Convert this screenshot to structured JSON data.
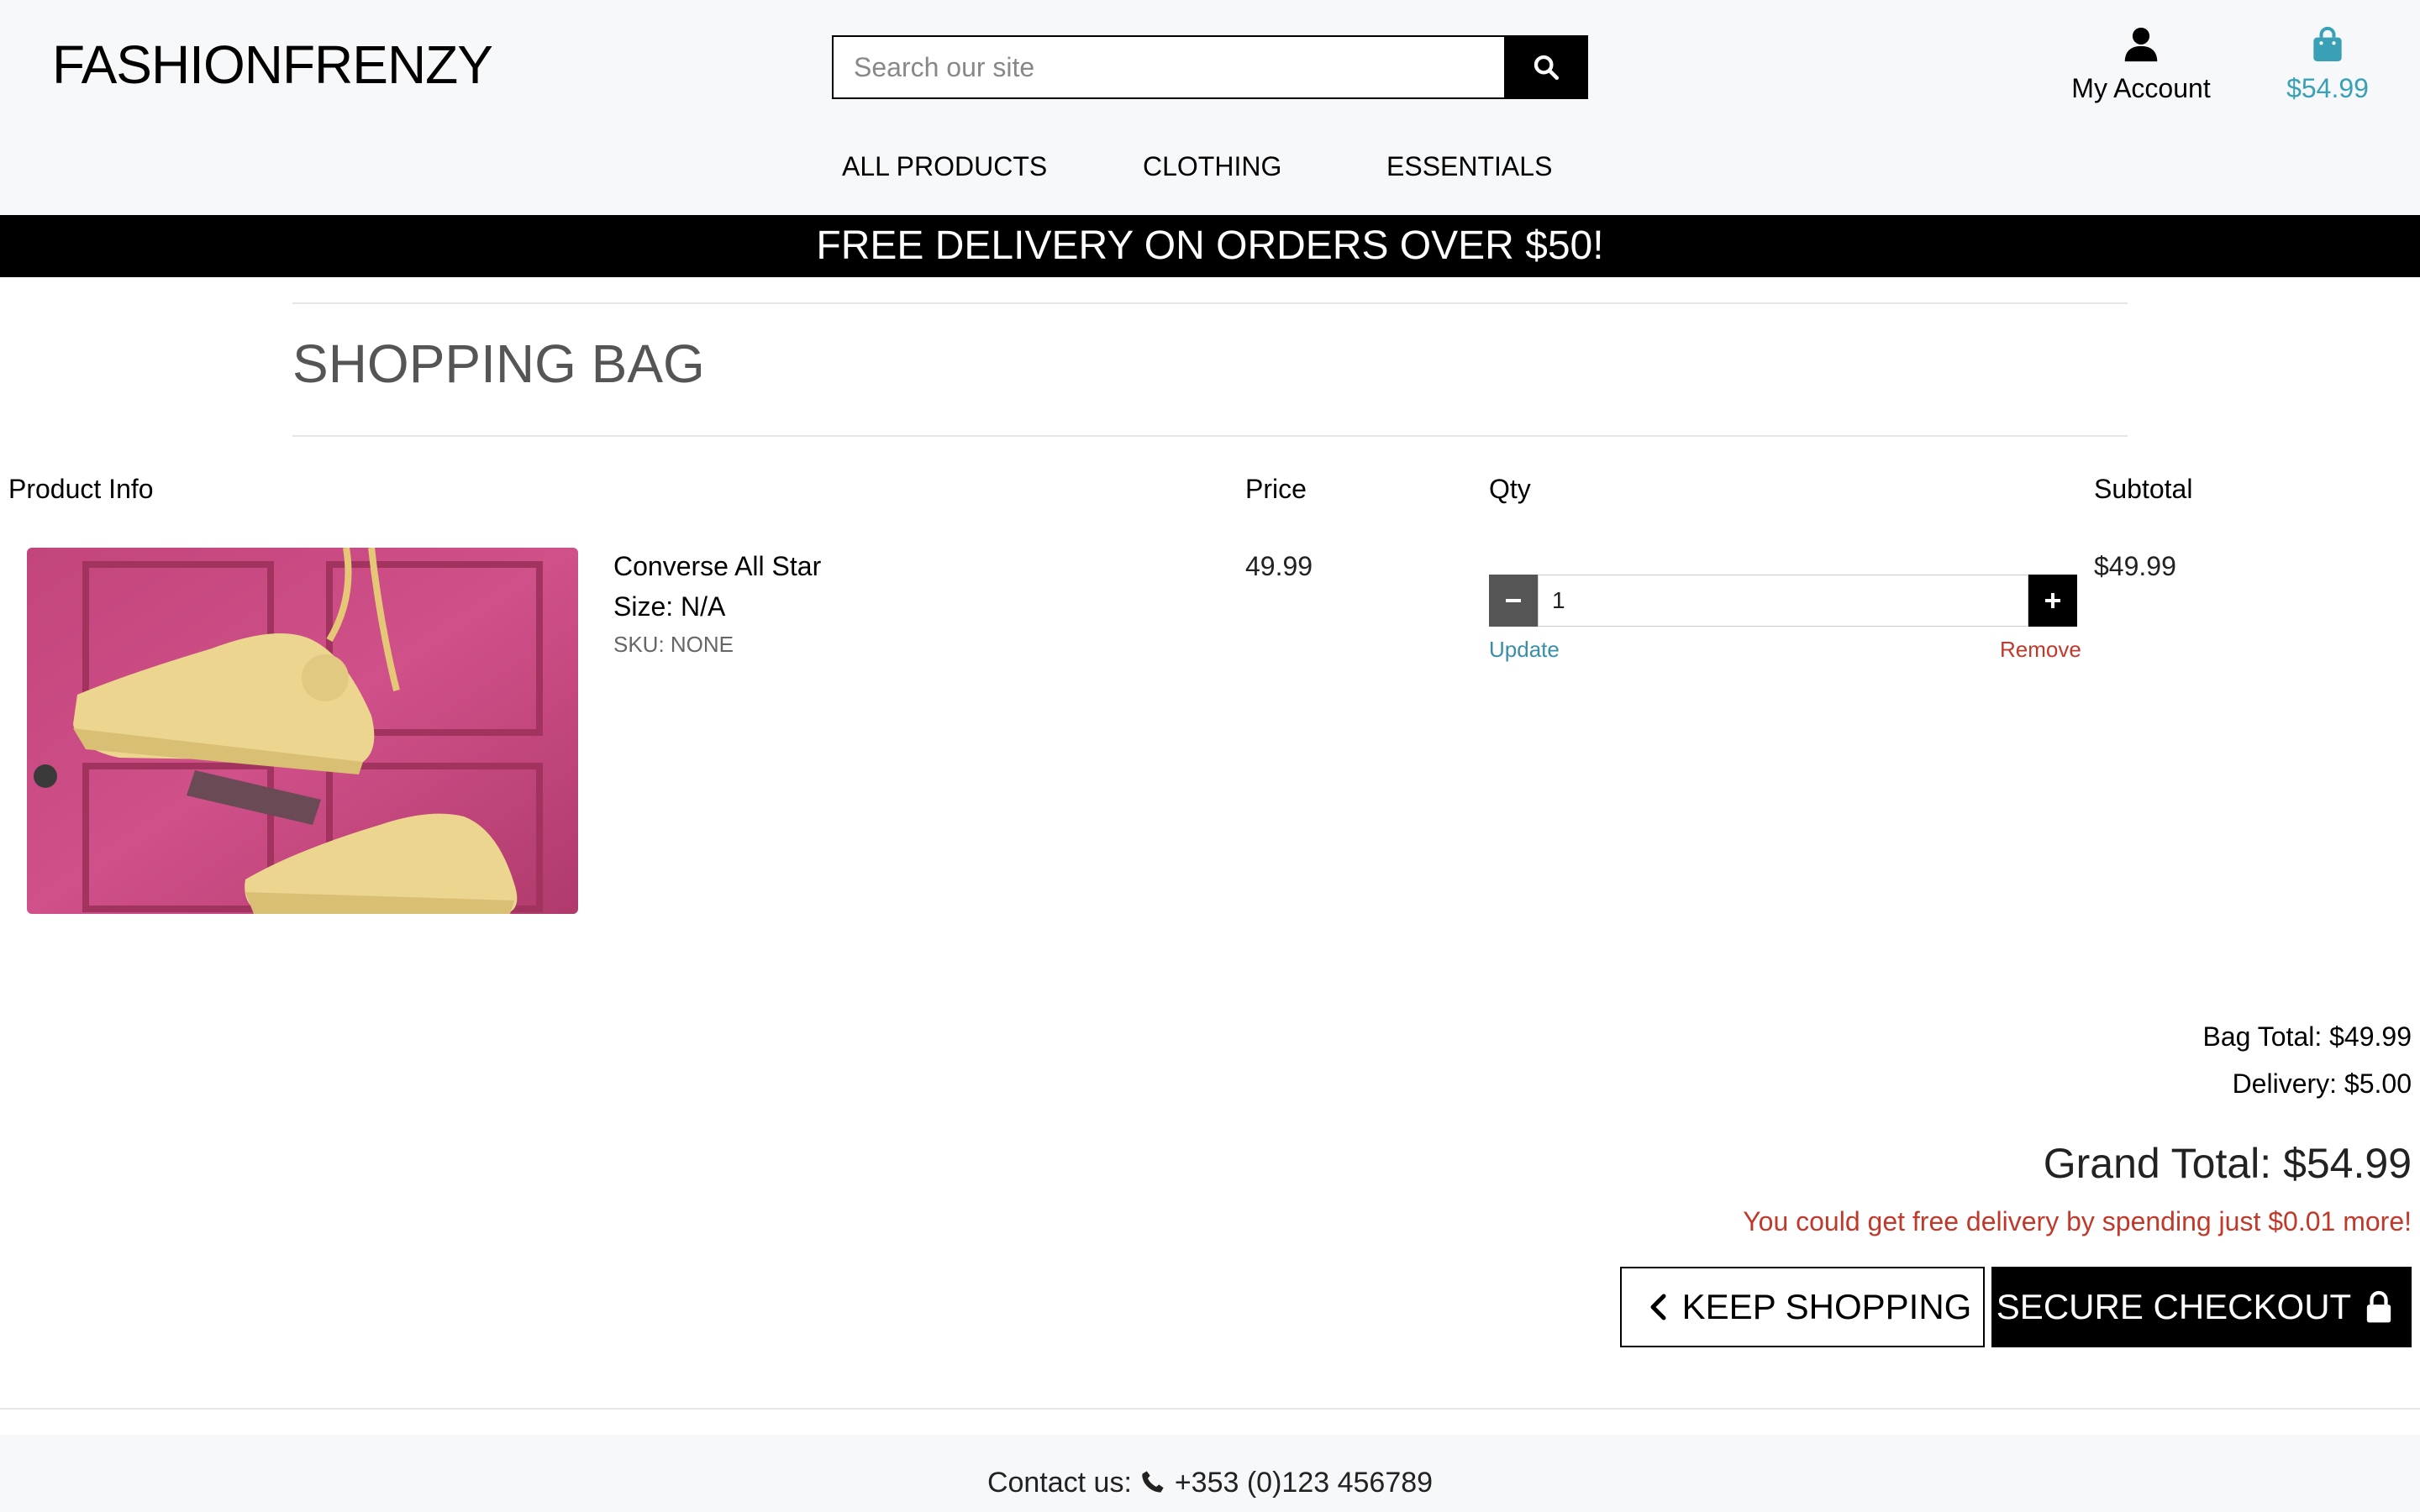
{
  "brand": {
    "logo": "FASHIONFRENZY"
  },
  "search": {
    "placeholder": "Search our site"
  },
  "account": {
    "label": "My Account"
  },
  "bag": {
    "amount": "$54.99"
  },
  "nav": {
    "items": [
      "ALL PRODUCTS",
      "CLOTHING",
      "ESSENTIALS"
    ]
  },
  "banner": {
    "text": "FREE DELIVERY ON ORDERS OVER $50!"
  },
  "page": {
    "title": "SHOPPING BAG"
  },
  "table": {
    "headers": {
      "product": "Product Info",
      "price": "Price",
      "qty": "Qty",
      "subtotal": "Subtotal"
    },
    "rows": [
      {
        "name": "Converse All Star",
        "size": "Size: N/A",
        "sku": "SKU: NONE",
        "price": "49.99",
        "qty": "1",
        "subtotal": "$49.99",
        "update_label": "Update",
        "remove_label": "Remove"
      }
    ]
  },
  "totals": {
    "bag_total": "Bag Total: $49.99",
    "delivery": "Delivery: $5.00",
    "grand_total": "Grand Total: $54.99",
    "free_delivery_msg": "You could get free delivery by spending just $0.01 more!"
  },
  "actions": {
    "keep_shopping": "KEEP SHOPPING",
    "secure_checkout": "SECURE CHECKOUT"
  },
  "footer": {
    "contact_label": "Contact us:",
    "phone": "+353 (0)123 456789"
  },
  "colors": {
    "accent": "#3aa0b5",
    "danger": "#c0392b",
    "dark": "#000000",
    "header_bg": "#f7f8fa"
  },
  "icons": {
    "search": "search-icon",
    "account": "user-icon",
    "bag": "shopping-bag-icon",
    "back": "chevron-left-icon",
    "lock": "lock-icon",
    "phone": "phone-icon"
  }
}
